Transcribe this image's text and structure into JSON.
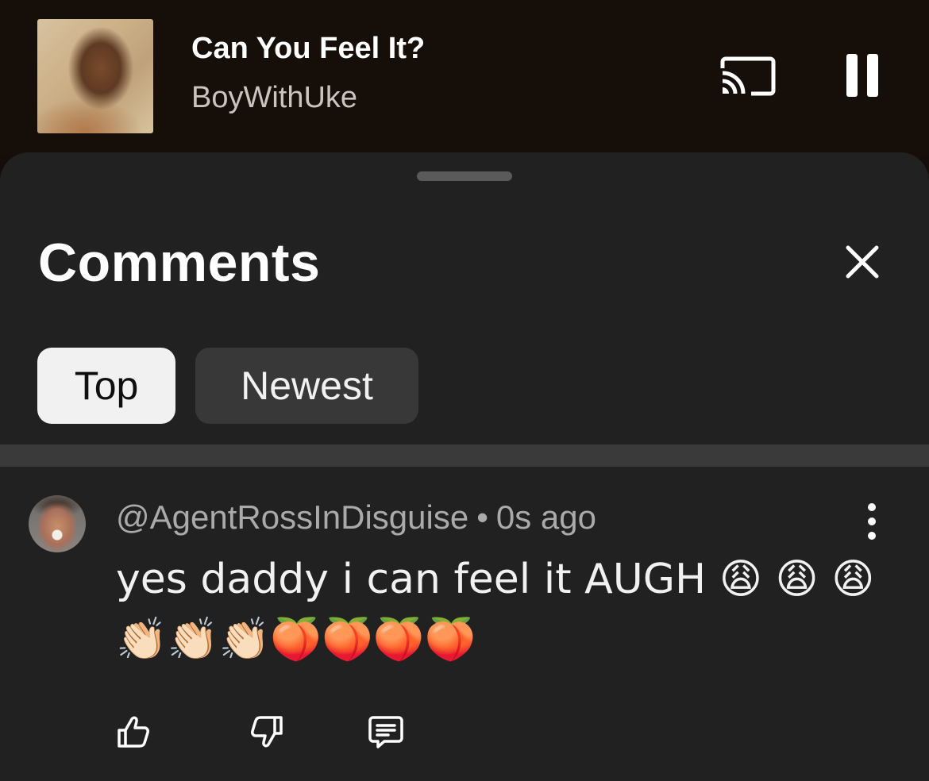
{
  "player": {
    "track_title": "Can You Feel It?",
    "artist": "BoyWithUke",
    "icons": {
      "cast": "cast-icon",
      "pause": "pause-icon"
    }
  },
  "comments_panel": {
    "title": "Comments",
    "close_icon": "close-icon",
    "filters": [
      {
        "label": "Top",
        "selected": true
      },
      {
        "label": "Newest",
        "selected": false
      }
    ]
  },
  "comment": {
    "author": "@AgentRossInDisguise",
    "separator": "•",
    "timestamp": "0s ago",
    "text": "yes daddy i can feel it AUGH 😩 😩 😩👏🏻👏🏻👏🏻🍑🍑🍑🍑",
    "actions": [
      "like-icon",
      "dislike-icon",
      "reply-icon"
    ]
  },
  "colors": {
    "player_bg": "#160e08",
    "sheet_bg": "#212121",
    "chip_selected_bg": "#f1f1f1",
    "chip_bg": "#383838",
    "meta_text": "#aaaaaa"
  }
}
